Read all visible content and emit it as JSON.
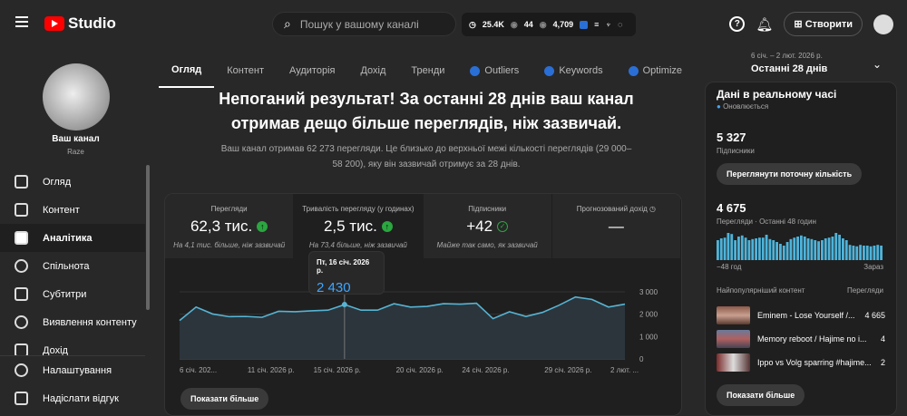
{
  "header": {
    "app": "Studio",
    "search_placeholder": "Пошук у вашому каналі",
    "stats": {
      "watch": "25.4K",
      "views_a": "44",
      "views_b": "4,709"
    },
    "create": "Створити"
  },
  "channel": {
    "name": "Ваш канал",
    "handle": "Raze"
  },
  "sidebar": {
    "items": [
      {
        "label": "Огляд",
        "icon": "dashboard-icon"
      },
      {
        "label": "Контент",
        "icon": "content-icon"
      },
      {
        "label": "Аналітика",
        "icon": "analytics-icon",
        "active": true
      },
      {
        "label": "Спільнота",
        "icon": "community-icon"
      },
      {
        "label": "Субтитри",
        "icon": "subtitles-icon"
      },
      {
        "label": "Виявлення контенту",
        "icon": "copyright-icon"
      },
      {
        "label": "Дохід",
        "icon": "earn-icon"
      }
    ],
    "bottom": [
      {
        "label": "Налаштування",
        "icon": "gear-icon"
      },
      {
        "label": "Надіслати відгук",
        "icon": "feedback-icon"
      }
    ]
  },
  "tabs": [
    {
      "label": "Огляд",
      "active": true
    },
    {
      "label": "Контент"
    },
    {
      "label": "Аудиторія"
    },
    {
      "label": "Дохід"
    },
    {
      "label": "Тренди"
    },
    {
      "label": "Outliers",
      "ext": true
    },
    {
      "label": "Keywords",
      "ext": true
    },
    {
      "label": "Optimize",
      "ext": true
    }
  ],
  "date_range": {
    "range": "6 січ. – 2 лют. 2026 р.",
    "label": "Останні 28 днів"
  },
  "summary": {
    "headline": "Непоганий результат! За останні 28 днів ваш канал отримав дещо більше переглядів, ніж зазвичай.",
    "description": "Ваш канал отримав 62 273 перегляди. Це близько до верхньої межі кількості переглядів (29 000–58 200), яку він зазвичай отримує за 28 днів."
  },
  "metrics": [
    {
      "label": "Перегляди",
      "value": "62,3 тис.",
      "note": "На 4,1 тис. більше, ніж зазвичай",
      "status": "up"
    },
    {
      "label": "Тривалість перегляду (у годинах)",
      "value": "2,5 тис.",
      "note": "На 73,4 більше, ніж зазвичай",
      "status": "up"
    },
    {
      "label": "Підписники",
      "value": "+42",
      "note": "Майже так само, як зазвичай",
      "status": "ok"
    },
    {
      "label": "Прогнозований дохід",
      "value": "—",
      "note": "",
      "status": "clock"
    }
  ],
  "chart_data": {
    "type": "area",
    "metric": "Тривалість перегляду (у годинах)",
    "values": [
      1720,
      2320,
      2010,
      1890,
      1900,
      1860,
      2130,
      2110,
      2150,
      2180,
      2430,
      2180,
      2180,
      2470,
      2320,
      2350,
      2470,
      2450,
      2490,
      1800,
      2110,
      1900,
      2080,
      2400,
      2770,
      2660,
      2320,
      2450
    ],
    "ylim": [
      0,
      3000
    ],
    "yticks": [
      "3 000",
      "2 000",
      "1 000",
      "0"
    ],
    "xticks": [
      {
        "i": 0,
        "label": "6 січ. 202..."
      },
      {
        "i": 5,
        "label": "11 січ. 2026 р."
      },
      {
        "i": 9,
        "label": "15 січ. 2026 р."
      },
      {
        "i": 14,
        "label": "20 січ. 2026 р."
      },
      {
        "i": 18,
        "label": "24 січ. 2026 р."
      },
      {
        "i": 23,
        "label": "29 січ. 2026 р."
      },
      {
        "i": 27,
        "label": "2 лют. ..."
      }
    ],
    "tooltip": {
      "index": 10,
      "date": "Пт, 16 січ. 2026 р.",
      "value": "2 430"
    },
    "color": "#3ea6ff"
  },
  "show_more": "Показати більше",
  "realtime": {
    "title": "Дані в реальному часі",
    "updating": "Оновлюється",
    "subs": "5 327",
    "subs_label": "Підписники",
    "subs_button": "Переглянути поточну кількість",
    "views": "4 675",
    "views_label": "Перегляди · Останні 48 годин",
    "bars": [
      55,
      60,
      62,
      75,
      72,
      55,
      65,
      68,
      62,
      55,
      58,
      60,
      62,
      62,
      70,
      58,
      55,
      50,
      45,
      40,
      50,
      58,
      62,
      65,
      68,
      65,
      60,
      58,
      55,
      52,
      55,
      60,
      62,
      65,
      75,
      70,
      60,
      55,
      42,
      40,
      38,
      42,
      40,
      40,
      38,
      40,
      42,
      40
    ],
    "axis_left": "−48 год",
    "axis_right": "Зараз",
    "top_header": "Найпопулярніший контент",
    "top_views_header": "Перегляди",
    "top": [
      {
        "title": "Eminem - Lose Yourself /...",
        "views": "4 665"
      },
      {
        "title": "Memory reboot / Hajime no i...",
        "views": "4"
      },
      {
        "title": "Ippo vs Volg sparring #hajime...",
        "views": "2"
      }
    ],
    "show_more": "Показати більше"
  }
}
